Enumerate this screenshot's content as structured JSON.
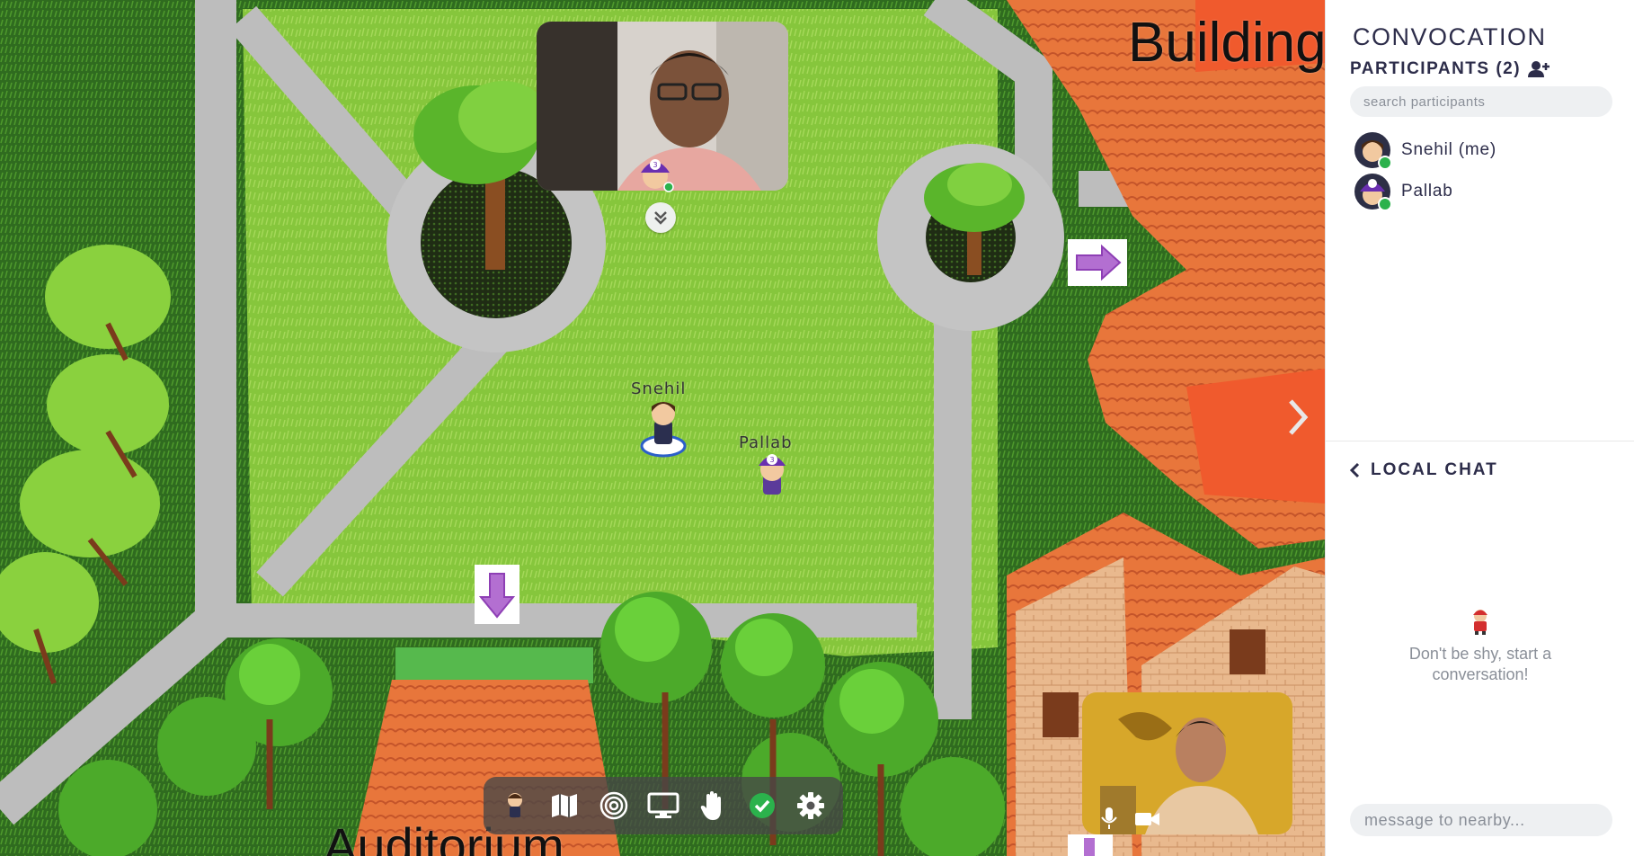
{
  "map": {
    "building_label": "Building",
    "auditorium_label": "Auditorium",
    "avatars": [
      {
        "name": "Snehil"
      },
      {
        "name": "Pallab"
      }
    ]
  },
  "videos": {
    "remote_name": "Pallab",
    "self_name": "Snehil"
  },
  "toolbar": {
    "items": [
      "avatar-icon",
      "map-icon",
      "target-icon",
      "screen-share-icon",
      "raise-hand-icon",
      "status-check-icon",
      "settings-icon"
    ]
  },
  "sidebar": {
    "room_title": "CONVOCATION",
    "participants_label": "PARTICIPANTS (2)",
    "search_placeholder": "search participants",
    "participants": [
      {
        "name": "Snehil (me)",
        "status": "online"
      },
      {
        "name": "Pallab",
        "status": "online"
      }
    ],
    "chat_title": "LOCAL CHAT",
    "empty_message": "Don't be shy, start a conversation!",
    "message_placeholder": "message to nearby..."
  },
  "colors": {
    "grass": "#7fc23a",
    "path": "#bdbdbd",
    "roof": "#e8763b",
    "accent_purple": "#8e3fb5",
    "status_green": "#2bb24c",
    "sidebar_text": "#2d2d4a"
  }
}
